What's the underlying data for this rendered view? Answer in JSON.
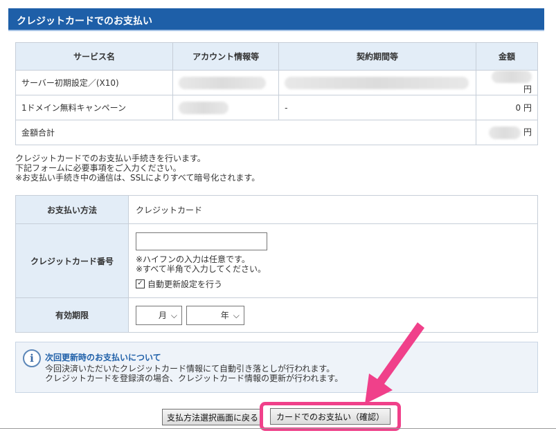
{
  "page": {
    "title": "クレジットカードでのお支払い"
  },
  "summary": {
    "headers": [
      "サービス名",
      "アカウント情報等",
      "契約期間等",
      "金額"
    ],
    "rows": [
      {
        "service": "サーバー初期設定／(X10)",
        "account": "",
        "period": "",
        "amount": "",
        "unit": "円"
      },
      {
        "service": "1ドメイン無料キャンペーン",
        "account": "",
        "period": "-",
        "amount": "0",
        "unit": "円"
      }
    ],
    "total_label": "金額合計",
    "total_unit": "円"
  },
  "notice": {
    "line1": "クレジットカードでのお支払い手続きを行います。",
    "line2": "下記フォームに必要事項をご入力ください。",
    "line3": "※お支払い手続き中の通信は、SSLによりすべて暗号化されます。"
  },
  "form": {
    "method_label": "お支払い方法",
    "method_value": "クレジットカード",
    "card_label": "クレジットカード番号",
    "card_value": "",
    "hint1": "※ハイフンの入力は任意です。",
    "hint2": "※すべて半角で入力してください。",
    "auto_renew_label": "自動更新設定を行う",
    "auto_renew_checked": true,
    "expiry_label": "有効期限",
    "month_value": "月",
    "year_value": "年"
  },
  "info": {
    "title": "次回更新時のお支払いについて",
    "line1": "今回決済いただいたクレジットカード情報にて自動引き落としが行われます。",
    "line2": "クレジットカードを登録済の場合、クレジットカード情報の更新が行われます。"
  },
  "buttons": {
    "back": "支払方法選択画面に戻る",
    "confirm": "カードでのお支払い（確認）"
  },
  "colors": {
    "header_bg": "#1e5fa8",
    "table_header_bg": "#e3edf7",
    "highlight": "#f0408a"
  }
}
